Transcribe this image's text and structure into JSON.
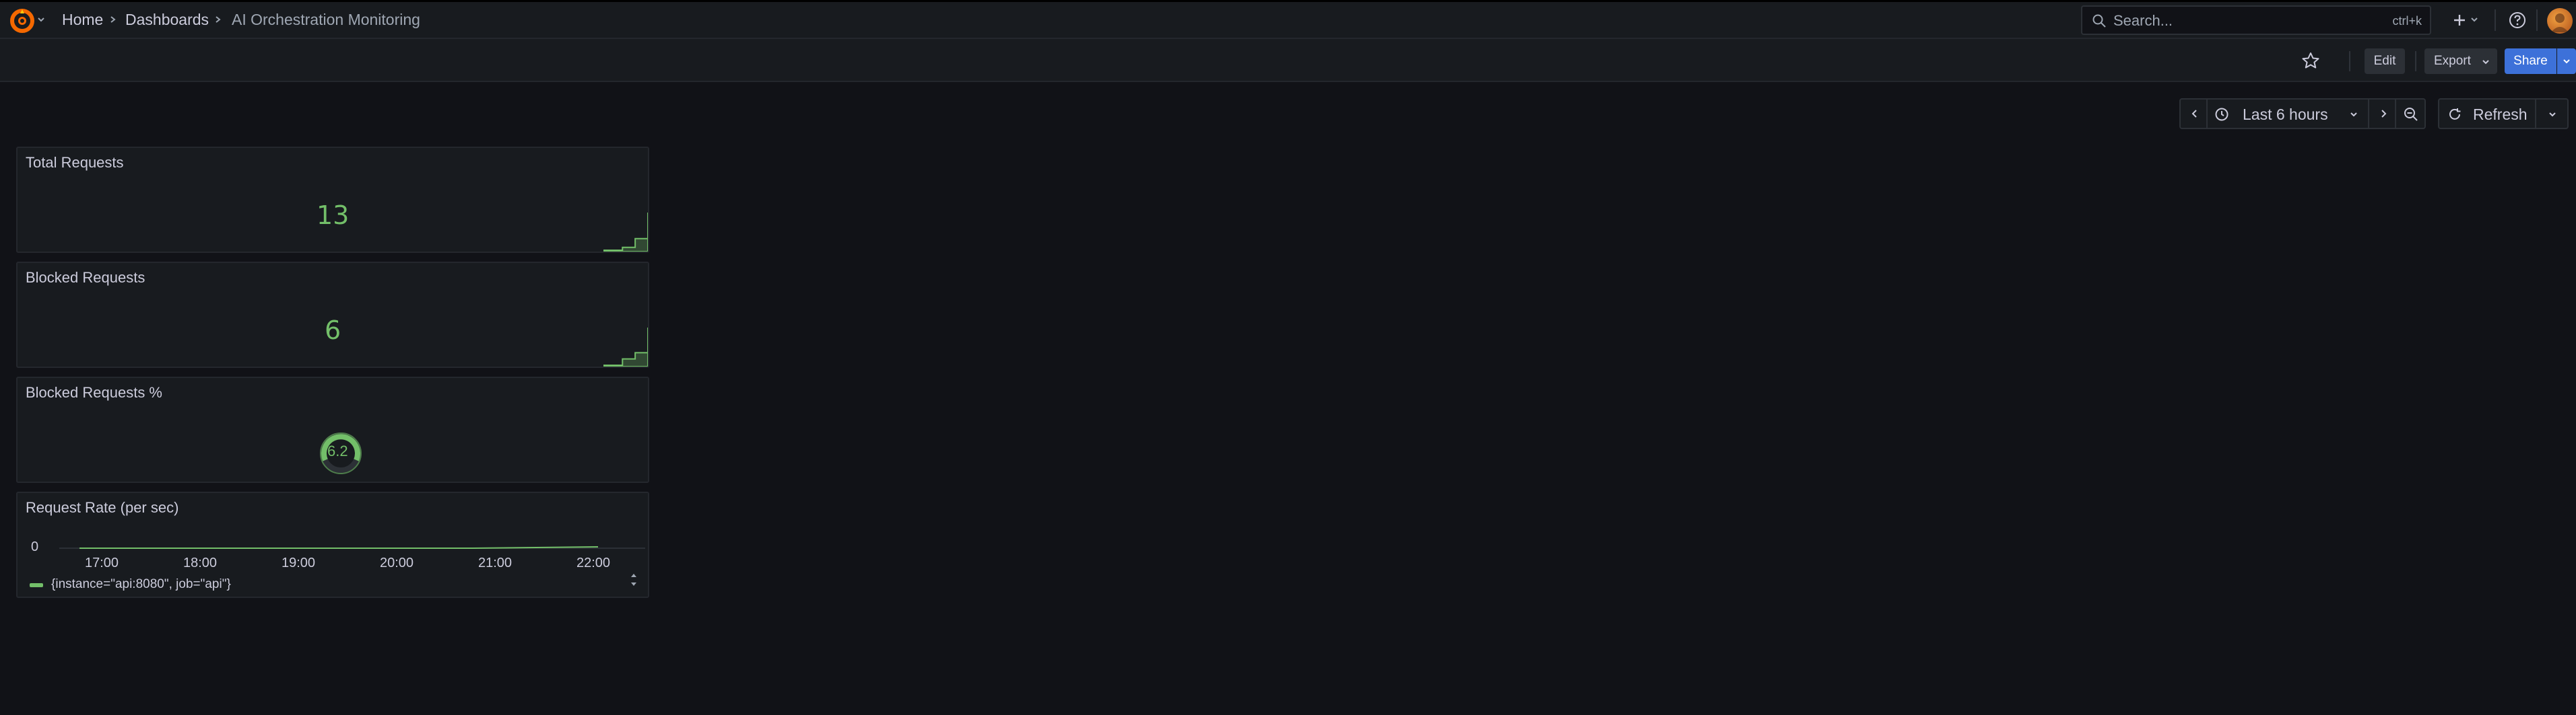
{
  "nav": {
    "breadcrumbs": [
      "Home",
      "Dashboards",
      "AI Orchestration Monitoring"
    ],
    "search_placeholder": "Search...",
    "search_shortcut": "ctrl+k"
  },
  "toolbar": {
    "edit_label": "Edit",
    "export_label": "Export",
    "share_label": "Share"
  },
  "time_picker": {
    "range_label": "Last 6 hours",
    "refresh_label": "Refresh"
  },
  "panels": {
    "total_requests": {
      "title": "Total Requests",
      "value": "13"
    },
    "blocked_requests": {
      "title": "Blocked Requests",
      "value": "6"
    },
    "blocked_pct": {
      "title": "Blocked Requests %",
      "value": "6.2"
    },
    "request_rate": {
      "title": "Request Rate (per sec)",
      "y_tick": "0",
      "x_ticks": [
        "17:00",
        "18:00",
        "19:00",
        "20:00",
        "21:00",
        "22:00"
      ],
      "legend": "{instance=\"api:8080\", job=\"api\"}"
    }
  },
  "colors": {
    "accent_green": "#73bf69",
    "primary_blue": "#3d71d9",
    "background": "#111217",
    "panel": "#181b1f"
  },
  "chart_data": [
    {
      "type": "area",
      "series": [
        {
          "values": [
            0,
            0,
            0,
            1,
            1,
            4,
            4,
            13
          ]
        }
      ]
    },
    {
      "type": "area",
      "series": [
        {
          "values": [
            0,
            0,
            0,
            1,
            1,
            2,
            2,
            6
          ]
        }
      ]
    },
    {
      "type": "line",
      "x": [
        "17:00",
        "18:00",
        "19:00",
        "20:00",
        "21:00",
        "22:00"
      ],
      "ylabel": "",
      "series": [
        {
          "name": "{instance=\"api:8080\", job=\"api\"}",
          "values": [
            0,
            0,
            0,
            0,
            0,
            0.02
          ]
        }
      ]
    }
  ]
}
